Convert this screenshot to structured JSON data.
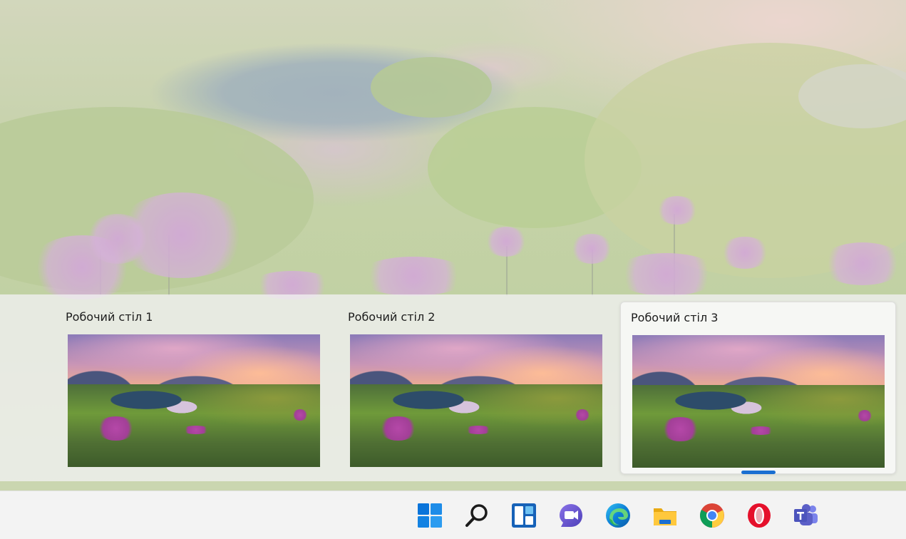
{
  "task_view": {
    "desktops": [
      {
        "title": "Робочий стіл 1",
        "active": false
      },
      {
        "title": "Робочий стіл 2",
        "active": false
      },
      {
        "title": "Робочий стіл 3",
        "active": true
      }
    ]
  },
  "taskbar": {
    "icons": [
      {
        "name": "start-icon"
      },
      {
        "name": "search-icon"
      },
      {
        "name": "widgets-icon"
      },
      {
        "name": "chat-icon"
      },
      {
        "name": "edge-icon"
      },
      {
        "name": "file-explorer-icon"
      },
      {
        "name": "chrome-icon"
      },
      {
        "name": "opera-icon"
      },
      {
        "name": "teams-icon"
      }
    ]
  },
  "colors": {
    "accent": "#1a6fd1",
    "start_blue": "#0a74da",
    "opera_red": "#e5102b",
    "teams_purple": "#5b5fc7"
  }
}
